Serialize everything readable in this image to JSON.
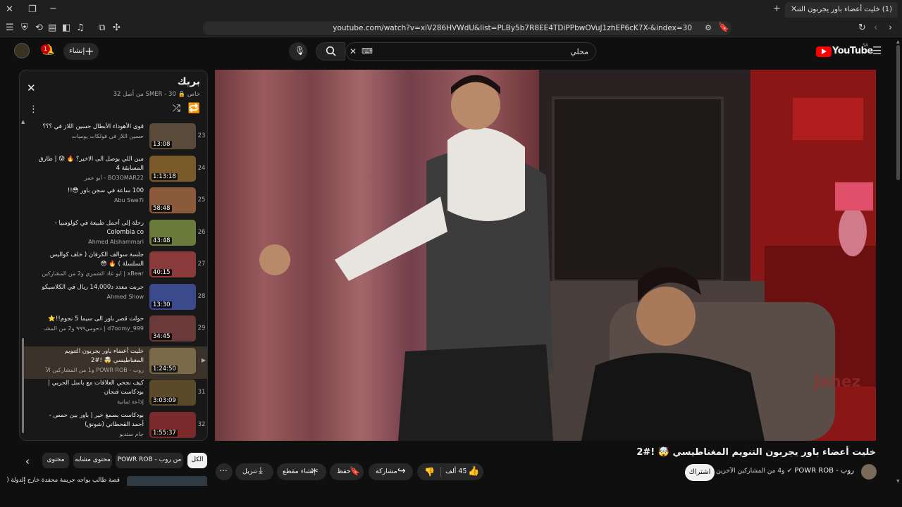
{
  "browser": {
    "tab_title": "(1) خليت أعضاء باور يجربون التنـ",
    "url": "youtube.com/watch?v=xiV286HVWdU&list=PLBy5b7R8EE4TDiPPbwOVuJ1zhEP6cK7X-&index=30"
  },
  "header": {
    "logo_text": "YouTube",
    "region": "SA",
    "search_value": "محلي",
    "create_label": "إنشاء",
    "notifications_count": "1"
  },
  "playlist": {
    "title": "بريك",
    "meta": "SMER - 30 من أصل 32",
    "meta_privacy": "خاص",
    "items": [
      {
        "num": "23",
        "title": "قوى الأهوداء الأبطال حسين اللاز في ؟؟؟",
        "channel": "حسين اللاز في فولكات يوميات",
        "duration": "13:08",
        "color": "#5a4a3a"
      },
      {
        "num": "24",
        "title": "مين اللي يوصل الى الاخير؟ 🔥 😰 | طارق المسابقة 4",
        "channel": "BO3OMAR22 - أبو عمر",
        "duration": "1:13:18",
        "color": "#7a5a2a"
      },
      {
        "num": "25",
        "title": "100 ساعة في سجن باور 😳!!",
        "channel": "Abu Swe7i",
        "duration": "58:48",
        "color": "#8a5a3a"
      },
      {
        "num": "26",
        "title": "رحلة إلى أجمل طبيعة في كولومبيا - Colombia co",
        "channel": "Ahmed Alshammari",
        "duration": "43:48",
        "color": "#6a7a3a"
      },
      {
        "num": "27",
        "title": "جلسة سوالف الكرفان ( خلف كواليس السلسلة ) 🔥 😳",
        "channel": "xBear | ابو عاد الشمري و2 من المشاركين",
        "duration": "40:15",
        "color": "#8a3a3a"
      },
      {
        "num": "28",
        "title": "جربت معدد د14,000 ريال في الكلاسيكو",
        "channel": "Ahmed Show",
        "duration": "13:30",
        "color": "#3a4a8a"
      },
      {
        "num": "29",
        "title": "حولت قصر باور الى سيما 5 نجوم!!⭐",
        "channel": "d7oomy_999 | دحومي٩٩٩ و2 من المشـ",
        "duration": "34:45",
        "color": "#6a3a3a"
      },
      {
        "num": "",
        "title": "خليت أعضاء باور يجربون التنويم المغناطيسي 🤯 !#2",
        "channel": "روب - POWR ROB و1 من المشاركين الآ",
        "duration": "1:24:50",
        "color": "#7a6a4a",
        "active": true
      },
      {
        "num": "31",
        "title": "كيف نجحي العلاقات مع باسل الحربي | بودكاست فنجان",
        "channel": "إذاعة ثمانية",
        "duration": "3:03:09",
        "color": "#5a4a2a"
      },
      {
        "num": "32",
        "title": "بودكاست بصمغ خير | باور بين حمص - أحمد القحطاني (شونق)",
        "channel": "جام ستديو",
        "duration": "1:55:37",
        "color": "#7a2a2a"
      }
    ]
  },
  "chips": [
    {
      "label": "الكل"
    },
    {
      "label": "من روب - POWR ROB"
    },
    {
      "label": "محتوى مشابه"
    },
    {
      "label": "محتوى"
    }
  ],
  "next_item_title": "قصة طالب يواجه جريمة محفدة خارج الدولة (",
  "video": {
    "title": "خليت أعضاء باور يجربون التنويم المغناطيسي 🤯 !#2",
    "channel": "روب - POWR ROB",
    "channel_sub": "و4 من المشاركين الآخرين",
    "subscribe_label": "اشتراك",
    "likes": "45 ألف",
    "share_label": "مشاركة",
    "save_label": "حفظ",
    "clip_label": "إنشاء مقطع",
    "download_label": "تنزيل",
    "watermark": "Jahez"
  }
}
